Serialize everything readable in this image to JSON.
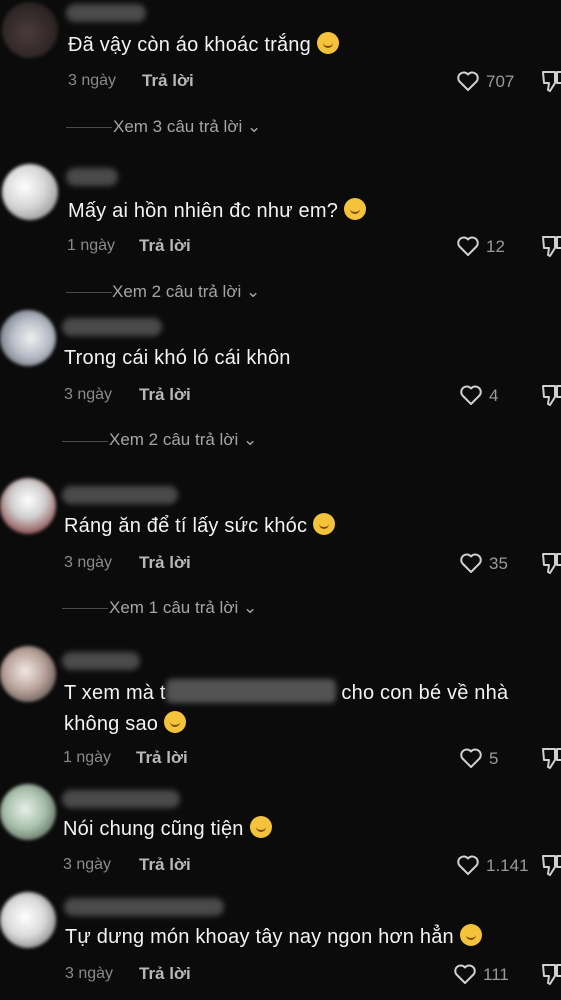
{
  "comments": [
    {
      "text": "Đã vậy còn áo khoác trắng",
      "time": "3 ngày",
      "reply": "Trả lời",
      "likes": "707",
      "view_replies": "Xem 3 câu trả lời"
    },
    {
      "text": "Mấy ai hồn nhiên đc như em?",
      "time": "1 ngày",
      "reply": "Trả lời",
      "likes": "12",
      "view_replies": "Xem 2 câu trả lời"
    },
    {
      "text": "Trong cái khó ló cái khôn",
      "time": "3 ngày",
      "reply": "Trả lời",
      "likes": "4",
      "view_replies": "Xem 2 câu trả lời"
    },
    {
      "text": "Ráng ăn để tí lấy sức khóc",
      "time": "3 ngày",
      "reply": "Trả lời",
      "likes": "35",
      "view_replies": "Xem 1 câu trả lời"
    },
    {
      "text_a": "T xem mà t",
      "text_b": "cho con bé về nhà",
      "text_c": "không sao",
      "time": "1 ngày",
      "reply": "Trả lời",
      "likes": "5"
    },
    {
      "text": "Nói chung cũng tiện",
      "time": "3 ngày",
      "reply": "Trả lời",
      "likes": "1.141"
    },
    {
      "text": "Tự dưng món khoay tây nay ngon hơn hẳn",
      "time": "3 ngày",
      "reply": "Trả lời",
      "likes": "111"
    }
  ],
  "icons": {
    "like": "heart-outline-icon",
    "dislike": "thumbs-down-icon",
    "expand": "chevron-down-icon"
  }
}
